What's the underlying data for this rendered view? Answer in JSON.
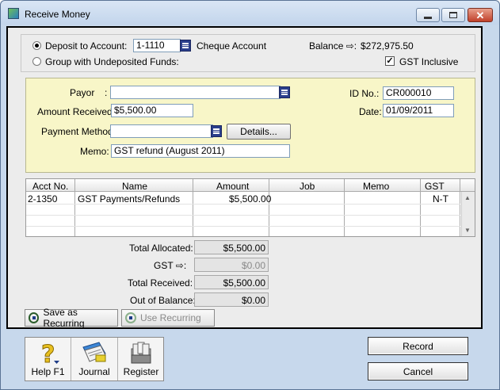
{
  "window": {
    "title": "Receive Money"
  },
  "deposit": {
    "label": "Deposit to Account:",
    "account_no": "1-1110",
    "account_name": "Cheque Account",
    "balance_label": "Balance ⇨:",
    "balance": "$272,975.50",
    "group_label": "Group with Undeposited Funds:",
    "gst_inclusive_label": "GST Inclusive",
    "gst_inclusive_checked": true
  },
  "form": {
    "payor_label": "Payor",
    "payor_colon": ":",
    "payor_value": "",
    "amount_label": "Amount Received:",
    "amount_value": "$5,500.00",
    "payment_method_label": "Payment Method:",
    "payment_method_value": "",
    "details_label": "Details...",
    "memo_label": "Memo:",
    "memo_value": "GST refund (August 2011)",
    "id_label": "ID No.:",
    "id_value": "CR000010",
    "date_label": "Date:",
    "date_value": "01/09/2011"
  },
  "grid": {
    "headers": [
      "Acct No.",
      "Name",
      "Amount",
      "Job",
      "Memo",
      "GST"
    ],
    "rows": [
      {
        "acct": "2-1350",
        "name": "GST Payments/Refunds",
        "amount": "$5,500.00",
        "job": "",
        "memo": "",
        "gst": "N-T"
      }
    ]
  },
  "totals": {
    "allocated_label": "Total Allocated:",
    "allocated_value": "$5,500.00",
    "gst_label": "GST ⇨:",
    "gst_value": "$0.00",
    "received_label": "Total Received:",
    "received_value": "$5,500.00",
    "out_of_balance_label": "Out of Balance:",
    "out_of_balance_value": "$0.00"
  },
  "recurring": {
    "save_label": "Save as Recurring",
    "use_label": "Use Recurring"
  },
  "toolbar": {
    "help_label": "Help F1",
    "journal_label": "Journal",
    "register_label": "Register"
  },
  "actions": {
    "record_label": "Record",
    "cancel_label": "Cancel"
  }
}
